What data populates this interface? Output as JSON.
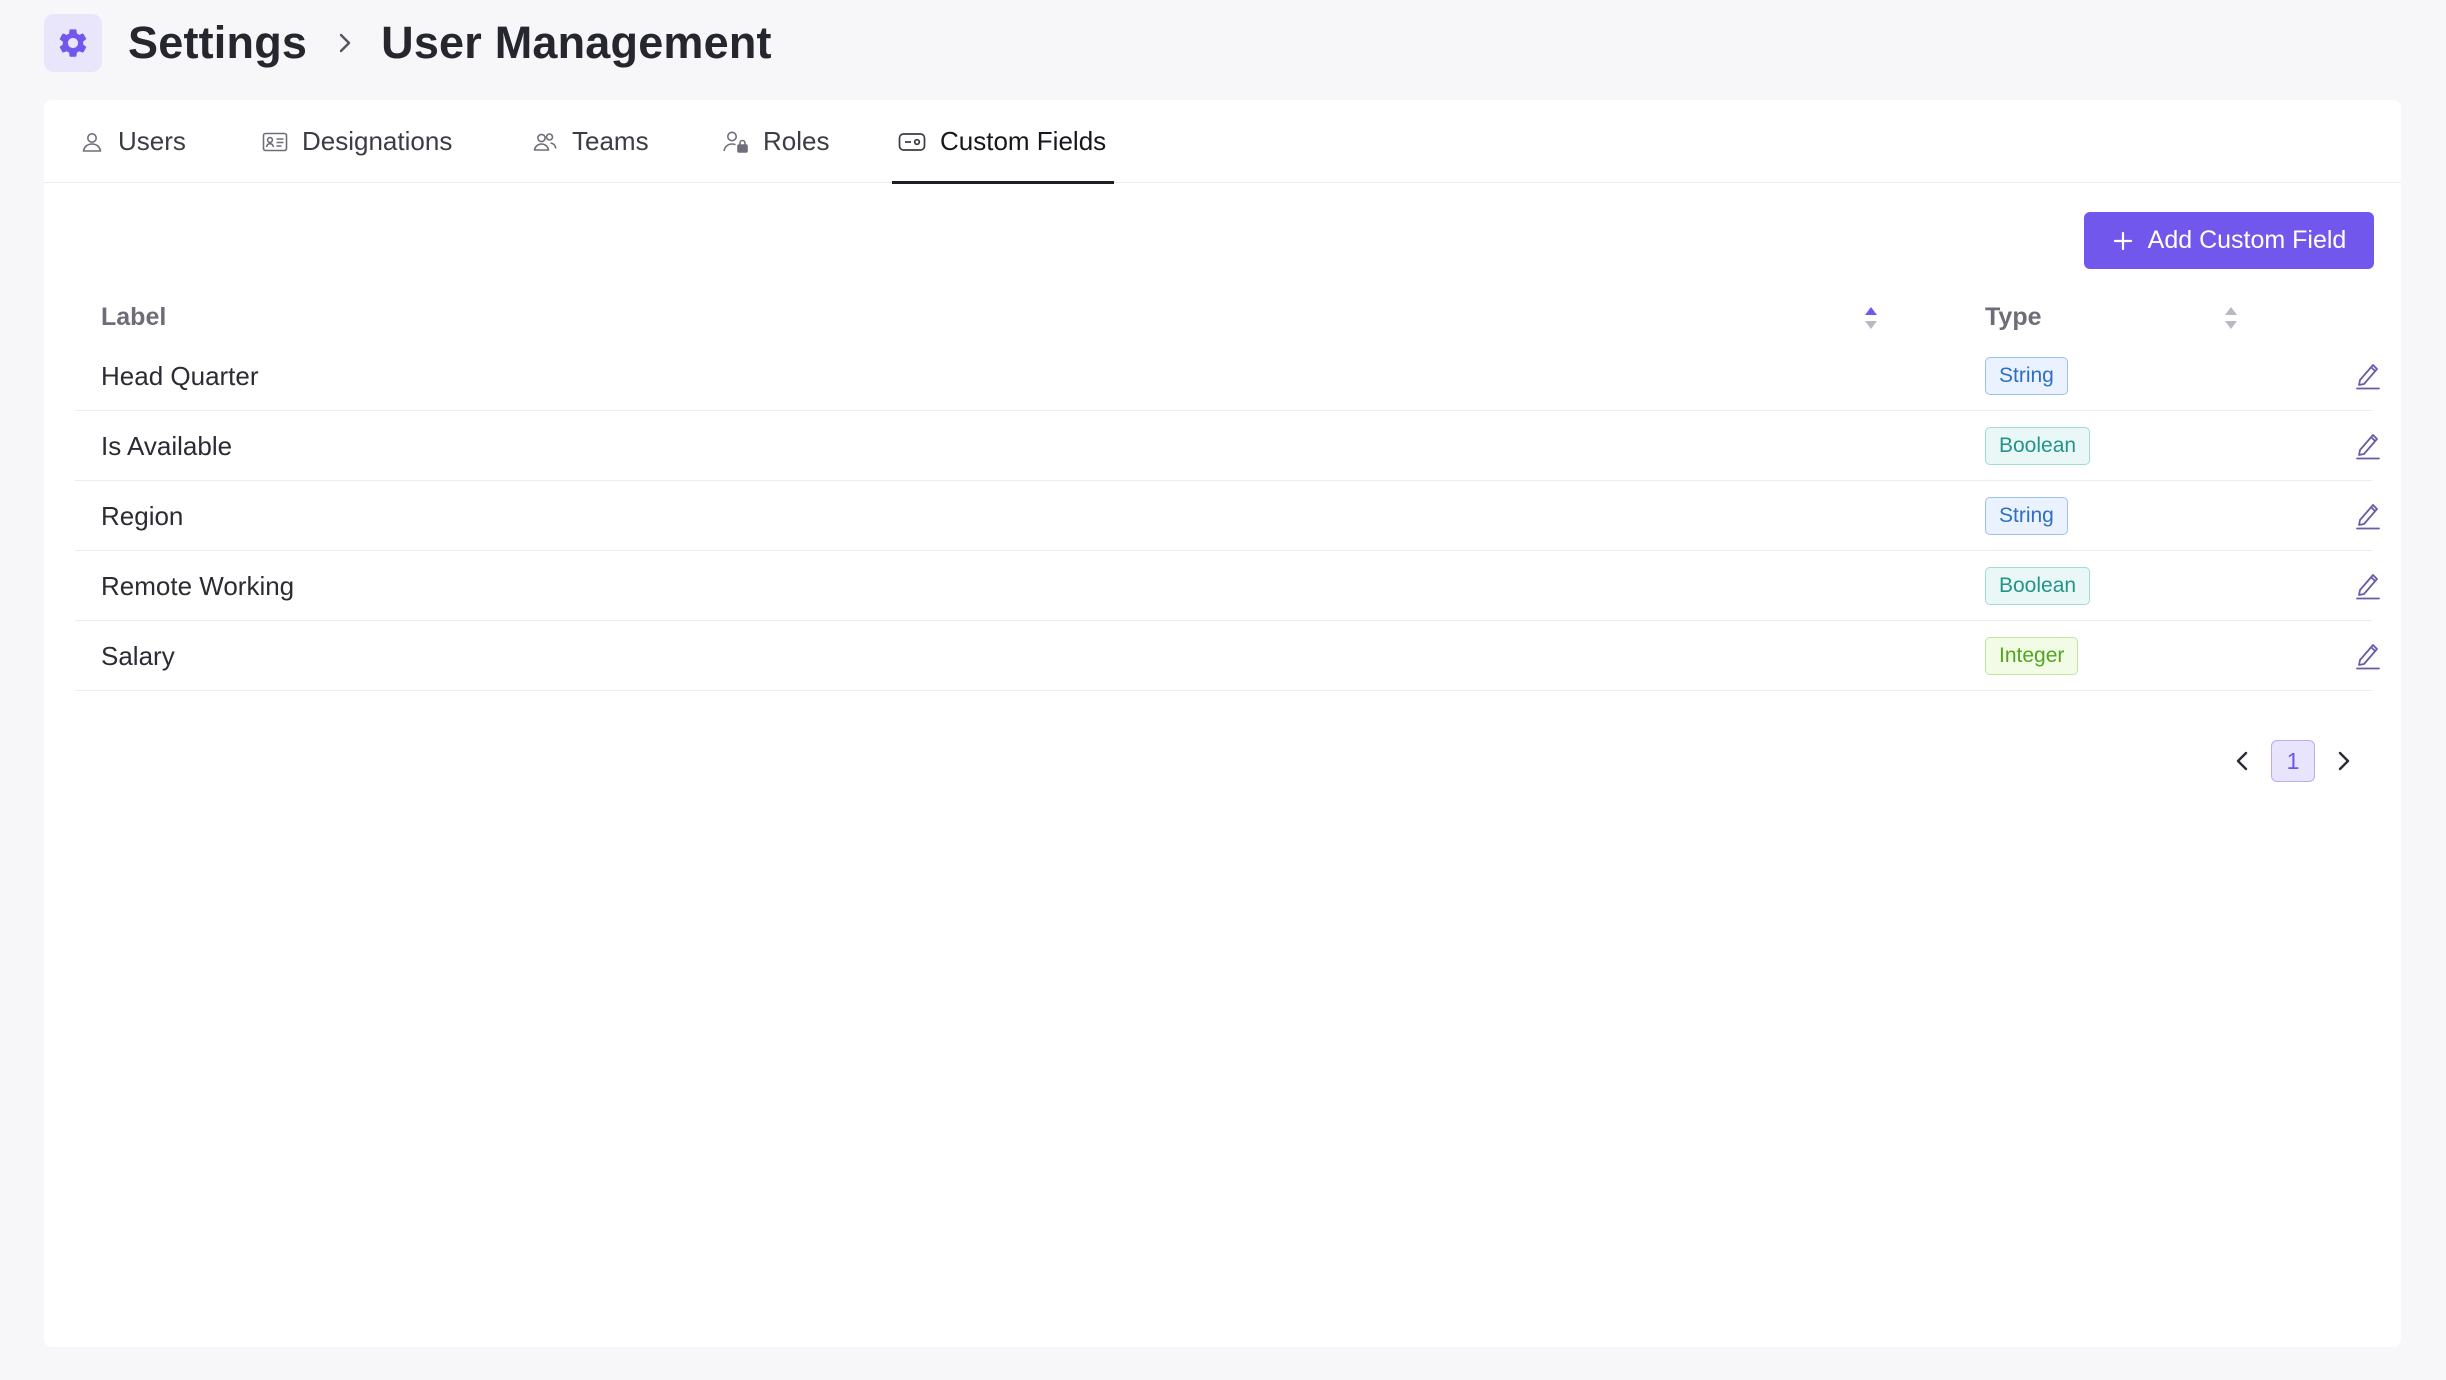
{
  "breadcrumb": {
    "root": "Settings",
    "current": "User Management"
  },
  "tabs": [
    {
      "label": "Users",
      "icon": "user-icon",
      "active": false
    },
    {
      "label": "Designations",
      "icon": "id-card-icon",
      "active": false
    },
    {
      "label": "Teams",
      "icon": "team-icon",
      "active": false
    },
    {
      "label": "Roles",
      "icon": "user-lock-icon",
      "active": false
    },
    {
      "label": "Custom Fields",
      "icon": "custom-field-icon",
      "active": true
    }
  ],
  "actions": {
    "add_label": "Add Custom Field"
  },
  "table": {
    "columns": [
      "Label",
      "Type"
    ],
    "rows": [
      {
        "label": "Head Quarter",
        "type": "String"
      },
      {
        "label": "Is Available",
        "type": "Boolean"
      },
      {
        "label": "Region",
        "type": "String"
      },
      {
        "label": "Remote Working",
        "type": "Boolean"
      },
      {
        "label": "Salary",
        "type": "Integer"
      }
    ]
  },
  "pagination": {
    "current_page": "1"
  },
  "colors": {
    "accent": "#7257ec",
    "string_badge_bg": "#eaf2ff",
    "string_badge_border": "#9cc0f0",
    "string_badge_text": "#2f6fc2",
    "boolean_badge_bg": "#e9f8f6",
    "boolean_badge_border": "#9fdcd4",
    "boolean_badge_text": "#24948a",
    "integer_badge_bg": "#f1fbe6",
    "integer_badge_border": "#bfe59d",
    "integer_badge_text": "#52a61f"
  }
}
